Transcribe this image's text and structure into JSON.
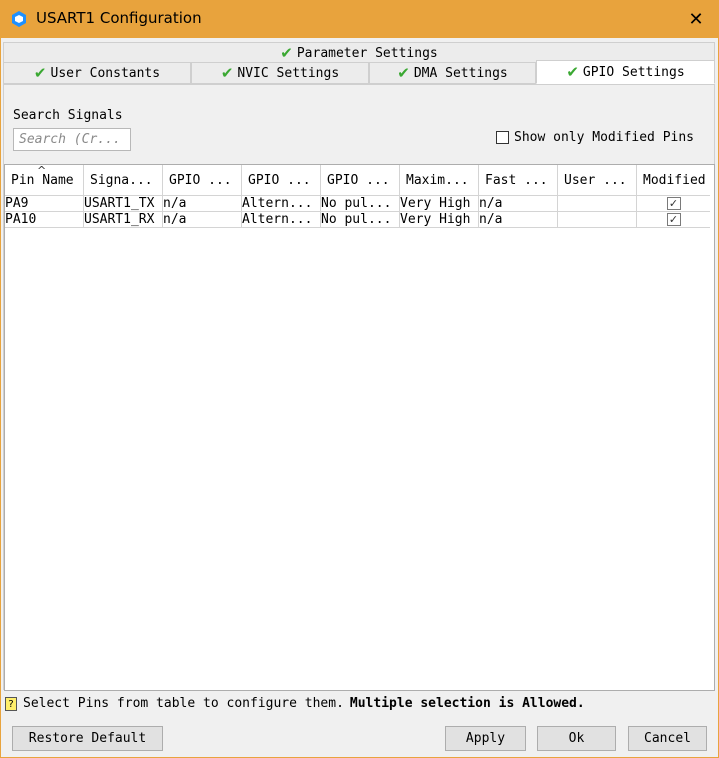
{
  "window": {
    "title": "USART1 Configuration",
    "close_glyph": "✕"
  },
  "tabs": {
    "top": {
      "label": "Parameter Settings"
    },
    "row": [
      {
        "label": "User Constants"
      },
      {
        "label": "NVIC Settings"
      },
      {
        "label": "DMA Settings"
      },
      {
        "label": "GPIO Settings",
        "active": true
      }
    ]
  },
  "search": {
    "label": "Search Signals",
    "placeholder": "Search (Cr..."
  },
  "filter": {
    "label": "Show only Modified Pins",
    "checked": false
  },
  "table": {
    "sort_indicator": "^",
    "columns": [
      "Pin Name",
      "Signa...",
      "GPIO ...",
      "GPIO ...",
      "GPIO ...",
      "Maxim...",
      "Fast ...",
      "User ...",
      "Modified"
    ],
    "rows": [
      {
        "cells": [
          "PA9",
          "USART1_TX",
          "n/a",
          "Altern...",
          "No pul...",
          "Very High",
          "n/a",
          ""
        ],
        "modified": "✓"
      },
      {
        "cells": [
          "PA10",
          "USART1_RX",
          "n/a",
          "Altern...",
          "No pul...",
          "Very High",
          "n/a",
          ""
        ],
        "modified": "✓"
      }
    ]
  },
  "status": {
    "icon": "?",
    "text": "Select Pins from table to configure them.",
    "bold_text": "Multiple selection is Allowed."
  },
  "buttons": {
    "restore": "Restore Default",
    "apply": "Apply",
    "ok": "Ok",
    "cancel": "Cancel"
  },
  "colors": {
    "titlebar": "#e8a33d",
    "check": "#3aa832",
    "app_icon": "#1e90ff"
  },
  "icons": {
    "app": "cube-icon",
    "tab_status": "check-icon",
    "help": "help-icon",
    "close": "close-icon"
  }
}
